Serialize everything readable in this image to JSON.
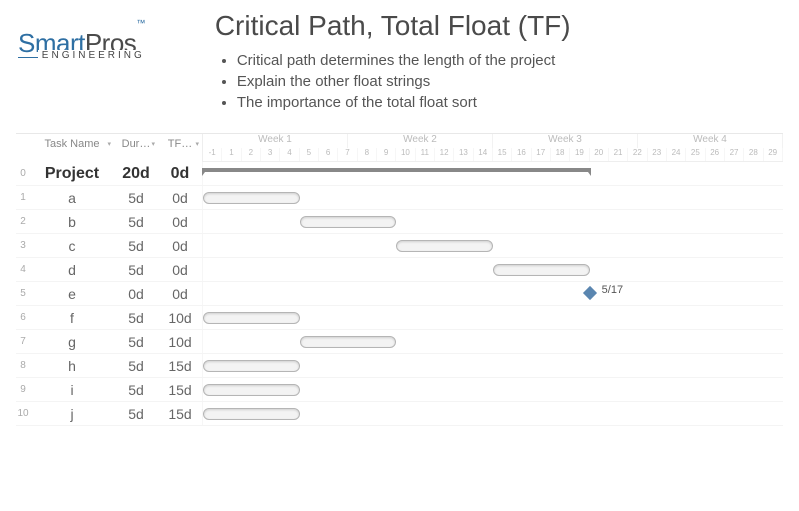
{
  "logo": {
    "smart": "Smart",
    "pros": "Pros",
    "tm": "™",
    "sub": "ENGINEERING"
  },
  "title": "Critical Path, Total Float (TF)",
  "bullets": [
    "Critical path determines the length of the project",
    "Explain the other float strings",
    "The importance of the total float sort"
  ],
  "columns": {
    "name": "Task Name",
    "dur": "Dur…",
    "tf": "TF…"
  },
  "weeks": [
    "Week 1",
    "Week 2",
    "Week 3",
    "Week 4"
  ],
  "days": [
    "-1",
    "1",
    "2",
    "3",
    "4",
    "5",
    "6",
    "7",
    "8",
    "9",
    "10",
    "11",
    "12",
    "13",
    "14",
    "15",
    "16",
    "17",
    "18",
    "19",
    "20",
    "21",
    "22",
    "23",
    "24",
    "25",
    "26",
    "27",
    "28",
    "29"
  ],
  "tasks": [
    {
      "n": "0",
      "name": "Project",
      "dur": "20d",
      "tf": "0d"
    },
    {
      "n": "1",
      "name": "a",
      "dur": "5d",
      "tf": "0d"
    },
    {
      "n": "2",
      "name": "b",
      "dur": "5d",
      "tf": "0d"
    },
    {
      "n": "3",
      "name": "c",
      "dur": "5d",
      "tf": "0d"
    },
    {
      "n": "4",
      "name": "d",
      "dur": "5d",
      "tf": "0d"
    },
    {
      "n": "5",
      "name": "e",
      "dur": "0d",
      "tf": "0d"
    },
    {
      "n": "6",
      "name": "f",
      "dur": "5d",
      "tf": "10d"
    },
    {
      "n": "7",
      "name": "g",
      "dur": "5d",
      "tf": "10d"
    },
    {
      "n": "8",
      "name": "h",
      "dur": "5d",
      "tf": "15d"
    },
    {
      "n": "9",
      "name": "i",
      "dur": "5d",
      "tf": "15d"
    },
    {
      "n": "10",
      "name": "j",
      "dur": "5d",
      "tf": "15d"
    }
  ],
  "chart_data": {
    "type": "gantt",
    "unit": "days",
    "milestone": {
      "task": "e",
      "day": 20,
      "label": "5/17"
    },
    "summary": {
      "task": "Project",
      "start": 0,
      "end": 20
    },
    "bars": [
      {
        "task": "a",
        "start": 0,
        "dur": 5
      },
      {
        "task": "b",
        "start": 5,
        "dur": 5
      },
      {
        "task": "c",
        "start": 10,
        "dur": 5
      },
      {
        "task": "d",
        "start": 15,
        "dur": 5
      },
      {
        "task": "f",
        "start": 0,
        "dur": 5
      },
      {
        "task": "g",
        "start": 5,
        "dur": 5
      },
      {
        "task": "h",
        "start": 0,
        "dur": 5
      },
      {
        "task": "i",
        "start": 0,
        "dur": 5
      },
      {
        "task": "j",
        "start": 0,
        "dur": 5
      }
    ],
    "total_days": 30
  }
}
